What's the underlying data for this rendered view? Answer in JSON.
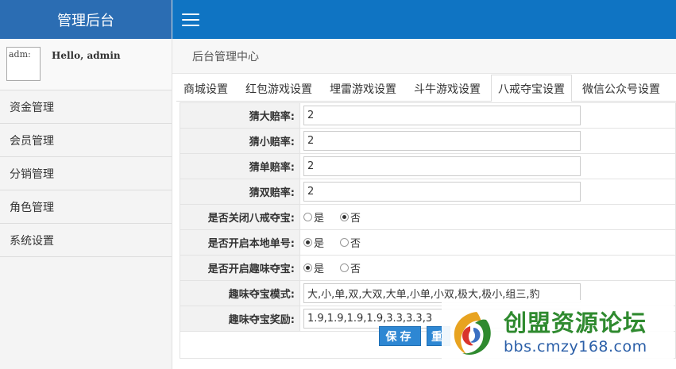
{
  "brand": {
    "title": "管理后台"
  },
  "user": {
    "avatar_alt": "adm:",
    "greeting": "Hello, admin"
  },
  "sidebar": {
    "items": [
      {
        "label": "资金管理"
      },
      {
        "label": "会员管理"
      },
      {
        "label": "分销管理"
      },
      {
        "label": "角色管理"
      },
      {
        "label": "系统设置"
      }
    ]
  },
  "breadcrumb": {
    "text": "后台管理中心"
  },
  "tabs": [
    {
      "label": "商城设置",
      "active": false
    },
    {
      "label": "红包游戏设置",
      "active": false
    },
    {
      "label": "埋雷游戏设置",
      "active": false
    },
    {
      "label": "斗牛游戏设置",
      "active": false
    },
    {
      "label": "八戒夺宝设置",
      "active": true
    },
    {
      "label": "微信公众号设置",
      "active": false
    }
  ],
  "form": {
    "guess_big": {
      "label": "猜大赔率:",
      "value": "2"
    },
    "guess_small": {
      "label": "猜小赔率:",
      "value": "2"
    },
    "guess_odd": {
      "label": "猜单赔率:",
      "value": "2"
    },
    "guess_even": {
      "label": "猜双赔率:",
      "value": "2"
    },
    "close_bajie": {
      "label": "是否关闭八戒夺宝:",
      "options": [
        "是",
        "否"
      ],
      "selected": "否"
    },
    "local_order": {
      "label": "是否开启本地单号:",
      "options": [
        "是",
        "否"
      ],
      "selected": "是"
    },
    "fun_mode_on": {
      "label": "是否开启趣味夺宝:",
      "options": [
        "是",
        "否"
      ],
      "selected": "是"
    },
    "fun_mode": {
      "label": "趣味夺宝模式:",
      "value": "大,小,单,双,大双,大单,小单,小双,极大,极小,组三,豹"
    },
    "fun_reward": {
      "label": "趣味夺宝奖励:",
      "value": "1.9,1.9,1.9,1.9,3.3,3.3,3"
    }
  },
  "buttons": {
    "save": "保存",
    "reset": "重"
  },
  "watermark": {
    "title": "创盟资源论坛",
    "url": "bbs.cmzy168.com"
  },
  "colors": {
    "topbar": "#0f74c3",
    "brand_bg": "#2b6db3",
    "button": "#2e87d3",
    "watermark_green": "#2f8a2f"
  }
}
